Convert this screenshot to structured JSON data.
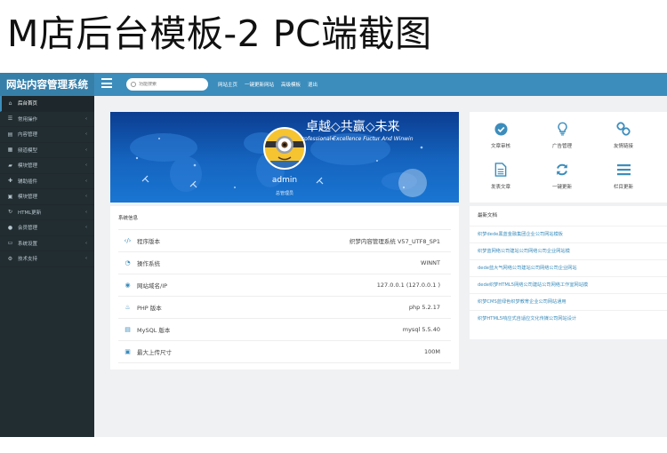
{
  "banner": {
    "title": "M店后台模板-2 PC端截图"
  },
  "header": {
    "logo": "网站内容管理系统",
    "search_placeholder": "功能搜索",
    "nav": [
      "网站主页",
      "一键更新网站",
      "高级模板",
      "退出"
    ]
  },
  "sidebar": {
    "items": [
      {
        "label": "后台首页",
        "icon": "home-icon",
        "has_arrow": false
      },
      {
        "label": "常用操作",
        "icon": "list-icon",
        "has_arrow": true
      },
      {
        "label": "内容管理",
        "icon": "file-icon",
        "has_arrow": true
      },
      {
        "label": "频道模型",
        "icon": "grid-icon",
        "has_arrow": true
      },
      {
        "label": "模块管理",
        "icon": "folder-icon",
        "has_arrow": true
      },
      {
        "label": "辅助插件",
        "icon": "plug-icon",
        "has_arrow": true
      },
      {
        "label": "模块管理",
        "icon": "box-icon",
        "has_arrow": true
      },
      {
        "label": "HTML更新",
        "icon": "refresh-icon",
        "has_arrow": true
      },
      {
        "label": "会员管理",
        "icon": "user-icon",
        "has_arrow": true
      },
      {
        "label": "系统设置",
        "icon": "monitor-icon",
        "has_arrow": true
      },
      {
        "label": "技术支持",
        "icon": "cogs-icon",
        "has_arrow": true
      }
    ]
  },
  "profile": {
    "slogan_cn": "卓越◇共赢◇未来",
    "slogan_en": "Professional Excellence Fuctur And Winwin",
    "name": "admin",
    "role": "总管理员"
  },
  "system_info": {
    "title": "系统信息",
    "rows": [
      {
        "label": "程序版本",
        "value": "织梦内容管理系统 V57_UTF8_SP1",
        "icon": "code-icon"
      },
      {
        "label": "操作系统",
        "value": "WINNT",
        "icon": "dashboard-icon"
      },
      {
        "label": "网站域名/IP",
        "value": "127.0.0.1 (127.0.0.1 )",
        "icon": "globe-icon"
      },
      {
        "label": "PHP 版本",
        "value": "php 5.2.17",
        "icon": "flame-icon"
      },
      {
        "label": "MySQL 版本",
        "value": "mysql 5.5.40",
        "icon": "database-icon"
      },
      {
        "label": "最大上传尺寸",
        "value": "100M",
        "icon": "upload-icon"
      }
    ]
  },
  "quick_actions": [
    {
      "label": "文章审核",
      "icon": "check-circle-icon"
    },
    {
      "label": "广告管理",
      "icon": "lightbulb-icon"
    },
    {
      "label": "友情链接",
      "icon": "link-icon"
    },
    {
      "label": "发表文章",
      "icon": "document-icon"
    },
    {
      "label": "一键更新",
      "icon": "sync-icon"
    },
    {
      "label": "栏目更新",
      "icon": "bars-icon"
    }
  ],
  "latest_docs": {
    "title": "最新文档",
    "items": [
      "织梦dede黑蓝金融集团企业公司网站模板",
      "织梦蓝网络公司建站公司网络公司企业网站模",
      "dede蓝大气网络公司建站公司网络公司企业网站",
      "dede织梦HTML5网络公司建站公司网络工作室网站模",
      "织梦CMS蓝绿色织梦教育企业公司网站通用",
      "织梦HTML5响应式自适应文化传媒公司网站设计"
    ]
  },
  "colors": {
    "header": "#3c8dbc",
    "logo_bg": "#367fa9",
    "sidebar": "#222d32",
    "accent": "#3c8dbc"
  }
}
